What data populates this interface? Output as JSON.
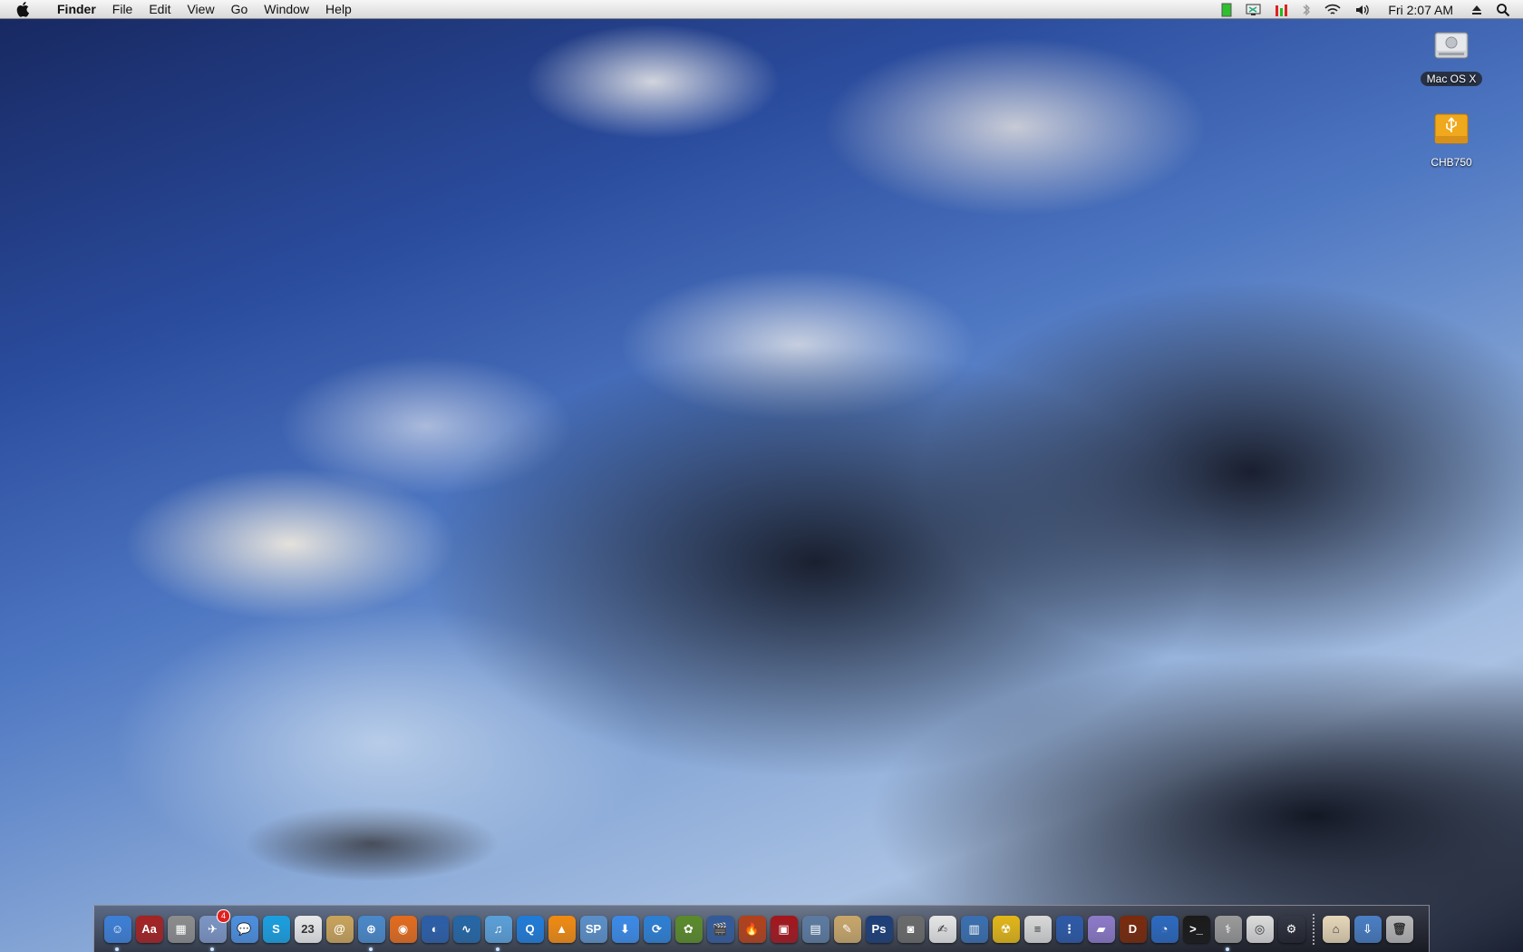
{
  "menubar": {
    "app_name": "Finder",
    "items": [
      "File",
      "Edit",
      "View",
      "Go",
      "Window",
      "Help"
    ],
    "clock": "Fri 2:07 AM",
    "status_icons": [
      "battery-green-icon",
      "display-icon",
      "cpu-meter-icon",
      "bluetooth-icon",
      "wifi-icon",
      "volume-icon",
      "eject-icon",
      "spotlight-icon"
    ]
  },
  "desktop": {
    "drives": [
      {
        "name": "Mac OS X",
        "icon": "hard-drive-icon"
      },
      {
        "name": "CHB750",
        "icon": "usb-drive-icon"
      }
    ]
  },
  "dock": {
    "apps": [
      {
        "name": "Finder",
        "icon": "finder-icon",
        "color": "#3d7fd6",
        "glyph": "☺",
        "running": true
      },
      {
        "name": "Dictionary",
        "icon": "dictionary-icon",
        "color": "#a52222",
        "glyph": "Aa",
        "running": false
      },
      {
        "name": "Calculator",
        "icon": "calculator-icon",
        "color": "#8c8c8c",
        "glyph": "▦",
        "running": false
      },
      {
        "name": "Mail",
        "icon": "mail-icon",
        "color": "#7c95c4",
        "glyph": "✈",
        "running": true,
        "badge": "4"
      },
      {
        "name": "iChat",
        "icon": "ichat-icon",
        "color": "#4c8fe0",
        "glyph": "💬",
        "running": false
      },
      {
        "name": "Skype",
        "icon": "skype-icon",
        "color": "#1a9fe0",
        "glyph": "S",
        "running": false
      },
      {
        "name": "iCal",
        "icon": "ical-icon",
        "color": "#e8e8e8",
        "glyph": "23",
        "running": false
      },
      {
        "name": "Address Book",
        "icon": "address-book-icon",
        "color": "#c9a35a",
        "glyph": "@",
        "running": false
      },
      {
        "name": "Safari",
        "icon": "safari-icon",
        "color": "#4a88c9",
        "glyph": "⊕",
        "running": true
      },
      {
        "name": "Firefox",
        "icon": "firefox-icon",
        "color": "#e36b1c",
        "glyph": "◉",
        "running": false
      },
      {
        "name": "Google Earth",
        "icon": "google-earth-icon",
        "color": "#2b5ea8",
        "glyph": "◐",
        "running": false
      },
      {
        "name": "Activity Monitor",
        "icon": "activity-monitor-icon",
        "color": "#2466a6",
        "glyph": "∿",
        "running": false
      },
      {
        "name": "iTunes",
        "icon": "itunes-icon",
        "color": "#5a9fd8",
        "glyph": "♫",
        "running": true
      },
      {
        "name": "QuickTime",
        "icon": "quicktime-icon",
        "color": "#1f7bd8",
        "glyph": "Q",
        "running": false
      },
      {
        "name": "VLC",
        "icon": "vlc-icon",
        "color": "#f08a10",
        "glyph": "▲",
        "running": false
      },
      {
        "name": "Speed Download",
        "icon": "speed-download-icon",
        "color": "#5b8fc8",
        "glyph": "SP",
        "running": false
      },
      {
        "name": "Transmission",
        "icon": "download-icon",
        "color": "#3a8ae8",
        "glyph": "⬇",
        "running": false
      },
      {
        "name": "Sync",
        "icon": "sync-icon",
        "color": "#2c7fd4",
        "glyph": "⟳",
        "running": false
      },
      {
        "name": "Adium",
        "icon": "adium-icon",
        "color": "#5a8a2a",
        "glyph": "✿",
        "running": false
      },
      {
        "name": "iMovie",
        "icon": "imovie-icon",
        "color": "#335a99",
        "glyph": "🎬",
        "running": false
      },
      {
        "name": "Burn",
        "icon": "burn-icon",
        "color": "#b2401a",
        "glyph": "🔥",
        "running": false
      },
      {
        "name": "Photo Booth",
        "icon": "photo-booth-icon",
        "color": "#a3151c",
        "glyph": "▣",
        "running": false
      },
      {
        "name": "iPhoto",
        "icon": "iphoto-icon",
        "color": "#5c7aa0",
        "glyph": "▤",
        "running": false
      },
      {
        "name": "Preview",
        "icon": "preview-icon",
        "color": "#c8a66a",
        "glyph": "✎",
        "running": false
      },
      {
        "name": "Photoshop",
        "icon": "photoshop-icon",
        "color": "#1c3e78",
        "glyph": "Ps",
        "running": false
      },
      {
        "name": "Image Capture",
        "icon": "camera-icon",
        "color": "#6a6a6a",
        "glyph": "◙",
        "running": false
      },
      {
        "name": "TextEdit",
        "icon": "textedit-icon",
        "color": "#e5e5e5",
        "glyph": "✍",
        "running": false
      },
      {
        "name": "Files",
        "icon": "files-icon",
        "color": "#3a6fb0",
        "glyph": "▥",
        "running": false
      },
      {
        "name": "Radiation",
        "icon": "radiation-icon",
        "color": "#e2b617",
        "glyph": "☢",
        "running": false
      },
      {
        "name": "Archive",
        "icon": "archive-icon",
        "color": "#d8d8d8",
        "glyph": "≡",
        "running": false
      },
      {
        "name": "Zipper",
        "icon": "zipper-icon",
        "color": "#2d5aa8",
        "glyph": "⋮",
        "running": false
      },
      {
        "name": "Folders",
        "icon": "folders-icon",
        "color": "#8d7ac9",
        "glyph": "▰",
        "running": false
      },
      {
        "name": "Diablo",
        "icon": "diablo-icon",
        "color": "#7a2a0c",
        "glyph": "D",
        "running": false
      },
      {
        "name": "Blender",
        "icon": "blender-icon",
        "color": "#2c6ac0",
        "glyph": "◔",
        "running": false
      },
      {
        "name": "Terminal",
        "icon": "terminal-icon",
        "color": "#1a1a1a",
        "glyph": ">_",
        "running": false
      },
      {
        "name": "Disk Utility",
        "icon": "disk-utility-icon",
        "color": "#9a9a9a",
        "glyph": "⚕",
        "running": true
      },
      {
        "name": "DVD Player",
        "icon": "dvd-icon",
        "color": "#dcdcdc",
        "glyph": "◎",
        "running": false
      },
      {
        "name": "System Preferences",
        "icon": "gear-icon",
        "color": "#777",
        "glyph": "⚙",
        "running": false
      }
    ],
    "stacks": [
      {
        "name": "Home",
        "icon": "home-icon",
        "color": "#e6d7b8",
        "glyph": "⌂"
      },
      {
        "name": "Downloads",
        "icon": "downloads-stack-icon",
        "color": "#4a7fc4",
        "glyph": "⇩"
      },
      {
        "name": "Trash",
        "icon": "trash-icon",
        "color": "#b9b9b9",
        "glyph": "🗑"
      }
    ]
  }
}
